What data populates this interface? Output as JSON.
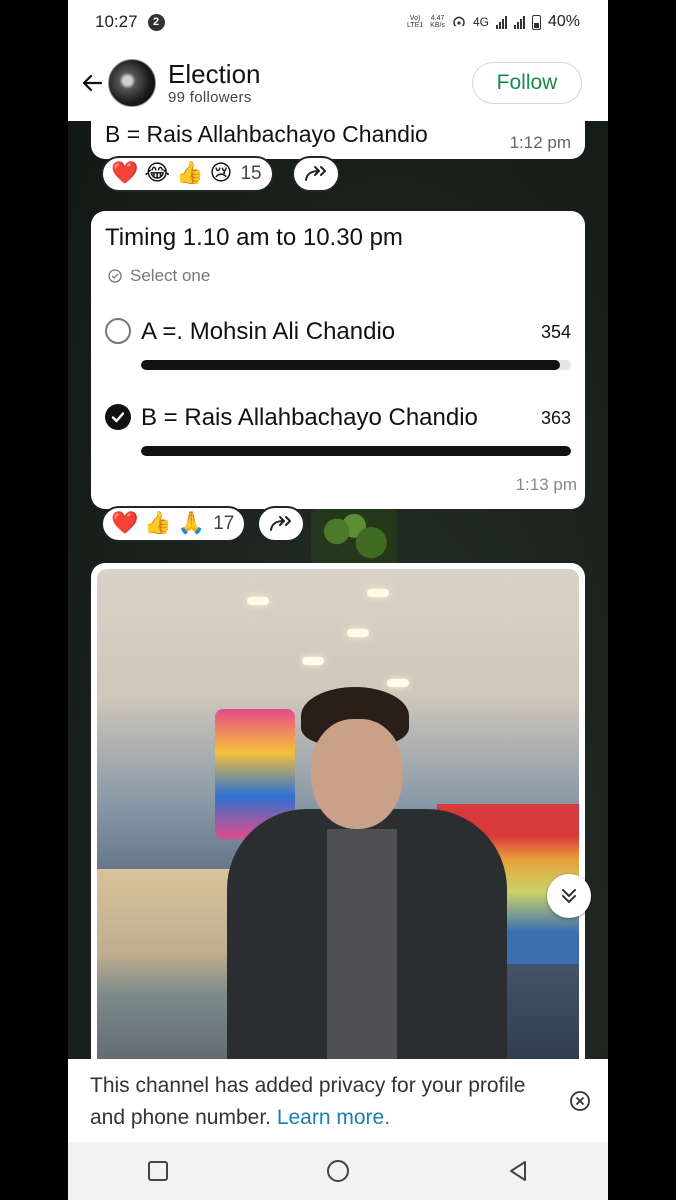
{
  "status_bar": {
    "time": "10:27",
    "notification_count": "2",
    "volte_top": "Vo)",
    "volte_bottom": "LTE1",
    "speed_top": "4.47",
    "speed_bottom": "KB/s",
    "network": "4G",
    "battery": "40%"
  },
  "header": {
    "channel_name": "Election",
    "followers": "99 followers",
    "follow_label": "Follow"
  },
  "messages": {
    "prev": {
      "text": "B = Rais Allahbachayo Chandio",
      "time": "1:12 pm",
      "reactions": [
        "❤️",
        "😂",
        "👍",
        "😢"
      ],
      "reaction_count": "15"
    },
    "poll": {
      "question": "Timing 1.10 am   to  10.30 pm",
      "hint": "Select one",
      "options": [
        {
          "label": "A =. Mohsin Ali Chandio",
          "votes": "354",
          "selected": false,
          "fill": 0.975
        },
        {
          "label": "B = Rais Allahbachayo Chandio",
          "votes": "363",
          "selected": true,
          "fill": 1.0
        }
      ],
      "time": "1:13 pm",
      "reactions": [
        "❤️",
        "👍",
        "🙏"
      ],
      "reaction_count": "17"
    }
  },
  "privacy": {
    "text": "This channel has added privacy for your profile and phone number.",
    "link": "Learn more."
  },
  "icons": {
    "back": "arrow-left-icon",
    "forward": "forward-icon",
    "check": "check-circle-icon",
    "scroll": "double-chevron-down-icon",
    "close": "close-circle-icon",
    "nav": [
      "square-icon",
      "circle-icon",
      "triangle-back-icon"
    ]
  }
}
